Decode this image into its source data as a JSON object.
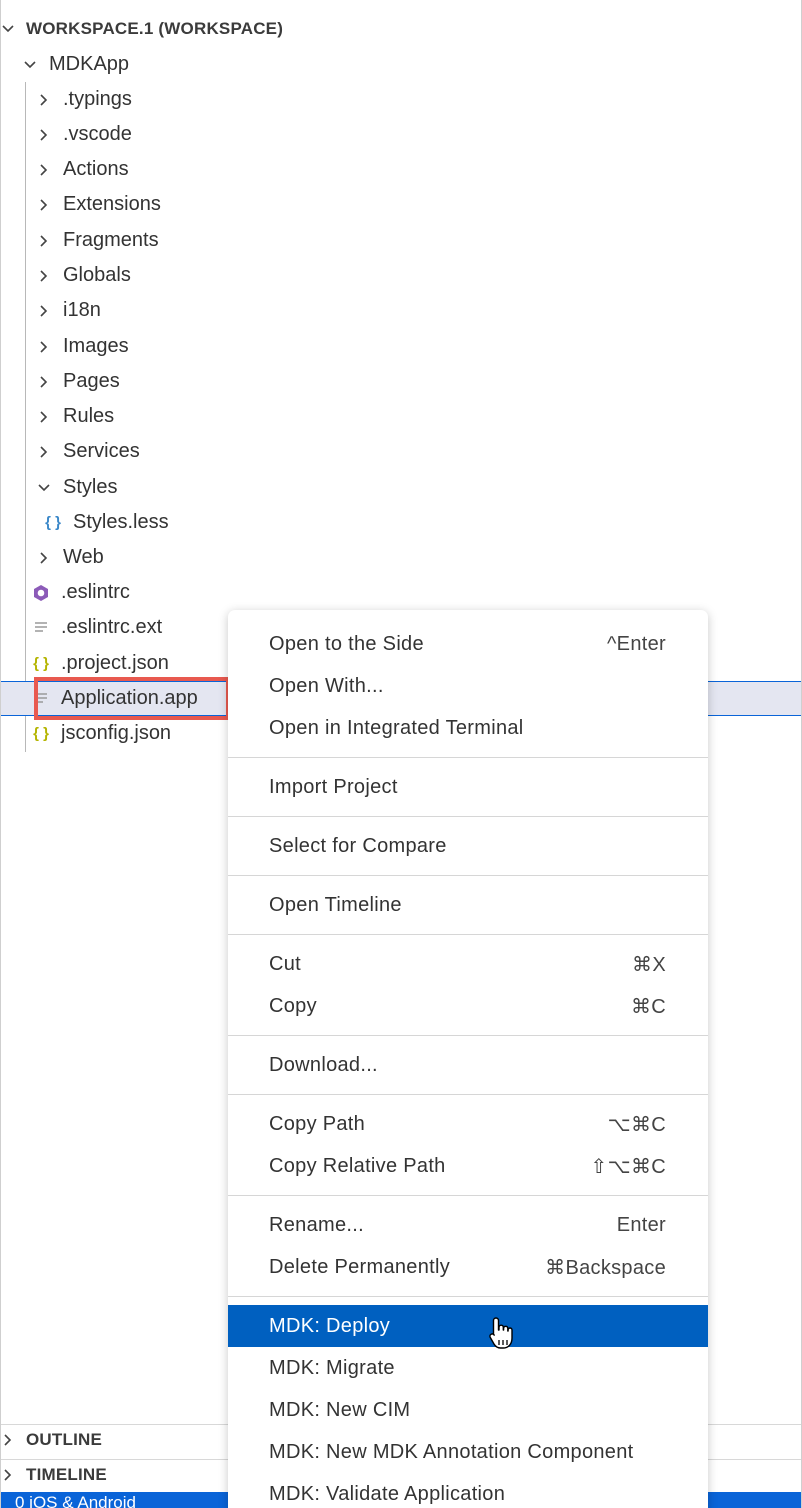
{
  "explorer": {
    "workspace_title": "WORKSPACE.1 (WORKSPACE)",
    "root_folder": "MDKApp",
    "folders": [
      ".typings",
      ".vscode",
      "Actions",
      "Extensions",
      "Fragments",
      "Globals",
      "i18n",
      "Images",
      "Pages",
      "Rules",
      "Services",
      "Styles"
    ],
    "styles_child": "Styles.less",
    "web_folder": "Web",
    "files": {
      "eslintrc": ".eslintrc",
      "eslintrc_ext": ".eslintrc.ext",
      "project_json": ".project.json",
      "application_app": "Application.app",
      "jsconfig_json": "jsconfig.json"
    },
    "selected_file": "Application.app"
  },
  "panels": {
    "outline": "OUTLINE",
    "timeline": "TIMELINE"
  },
  "statusbar": {
    "text": "0    iOS & Android"
  },
  "context_menu": {
    "open_to_side": {
      "label": "Open to the Side",
      "shortcut": "^Enter"
    },
    "open_with": {
      "label": "Open With..."
    },
    "open_terminal": {
      "label": "Open in Integrated Terminal"
    },
    "import_project": {
      "label": "Import Project"
    },
    "select_compare": {
      "label": "Select for Compare"
    },
    "open_timeline": {
      "label": "Open Timeline"
    },
    "cut": {
      "label": "Cut",
      "shortcut": "⌘X"
    },
    "copy": {
      "label": "Copy",
      "shortcut": "⌘C"
    },
    "download": {
      "label": "Download..."
    },
    "copy_path": {
      "label": "Copy Path",
      "shortcut": "⌥⌘C"
    },
    "copy_relative_path": {
      "label": "Copy Relative Path",
      "shortcut": "⇧⌥⌘C"
    },
    "rename": {
      "label": "Rename...",
      "shortcut": "Enter"
    },
    "delete_permanently": {
      "label": "Delete Permanently",
      "shortcut": "⌘Backspace"
    },
    "mdk_deploy": {
      "label": "MDK: Deploy"
    },
    "mdk_migrate": {
      "label": "MDK: Migrate"
    },
    "mdk_new_cim": {
      "label": "MDK: New CIM"
    },
    "mdk_new_annotation": {
      "label": "MDK: New MDK Annotation Component"
    },
    "mdk_validate": {
      "label": "MDK: Validate Application"
    }
  },
  "colors": {
    "menu_active_bg": "#0060c0",
    "selection_bg": "#e4e6f1",
    "highlight_border": "#e8594f",
    "json_icon": "#b4b400",
    "less_icon": "#3a87c8",
    "eslint_icon": "#8c5bb8"
  }
}
